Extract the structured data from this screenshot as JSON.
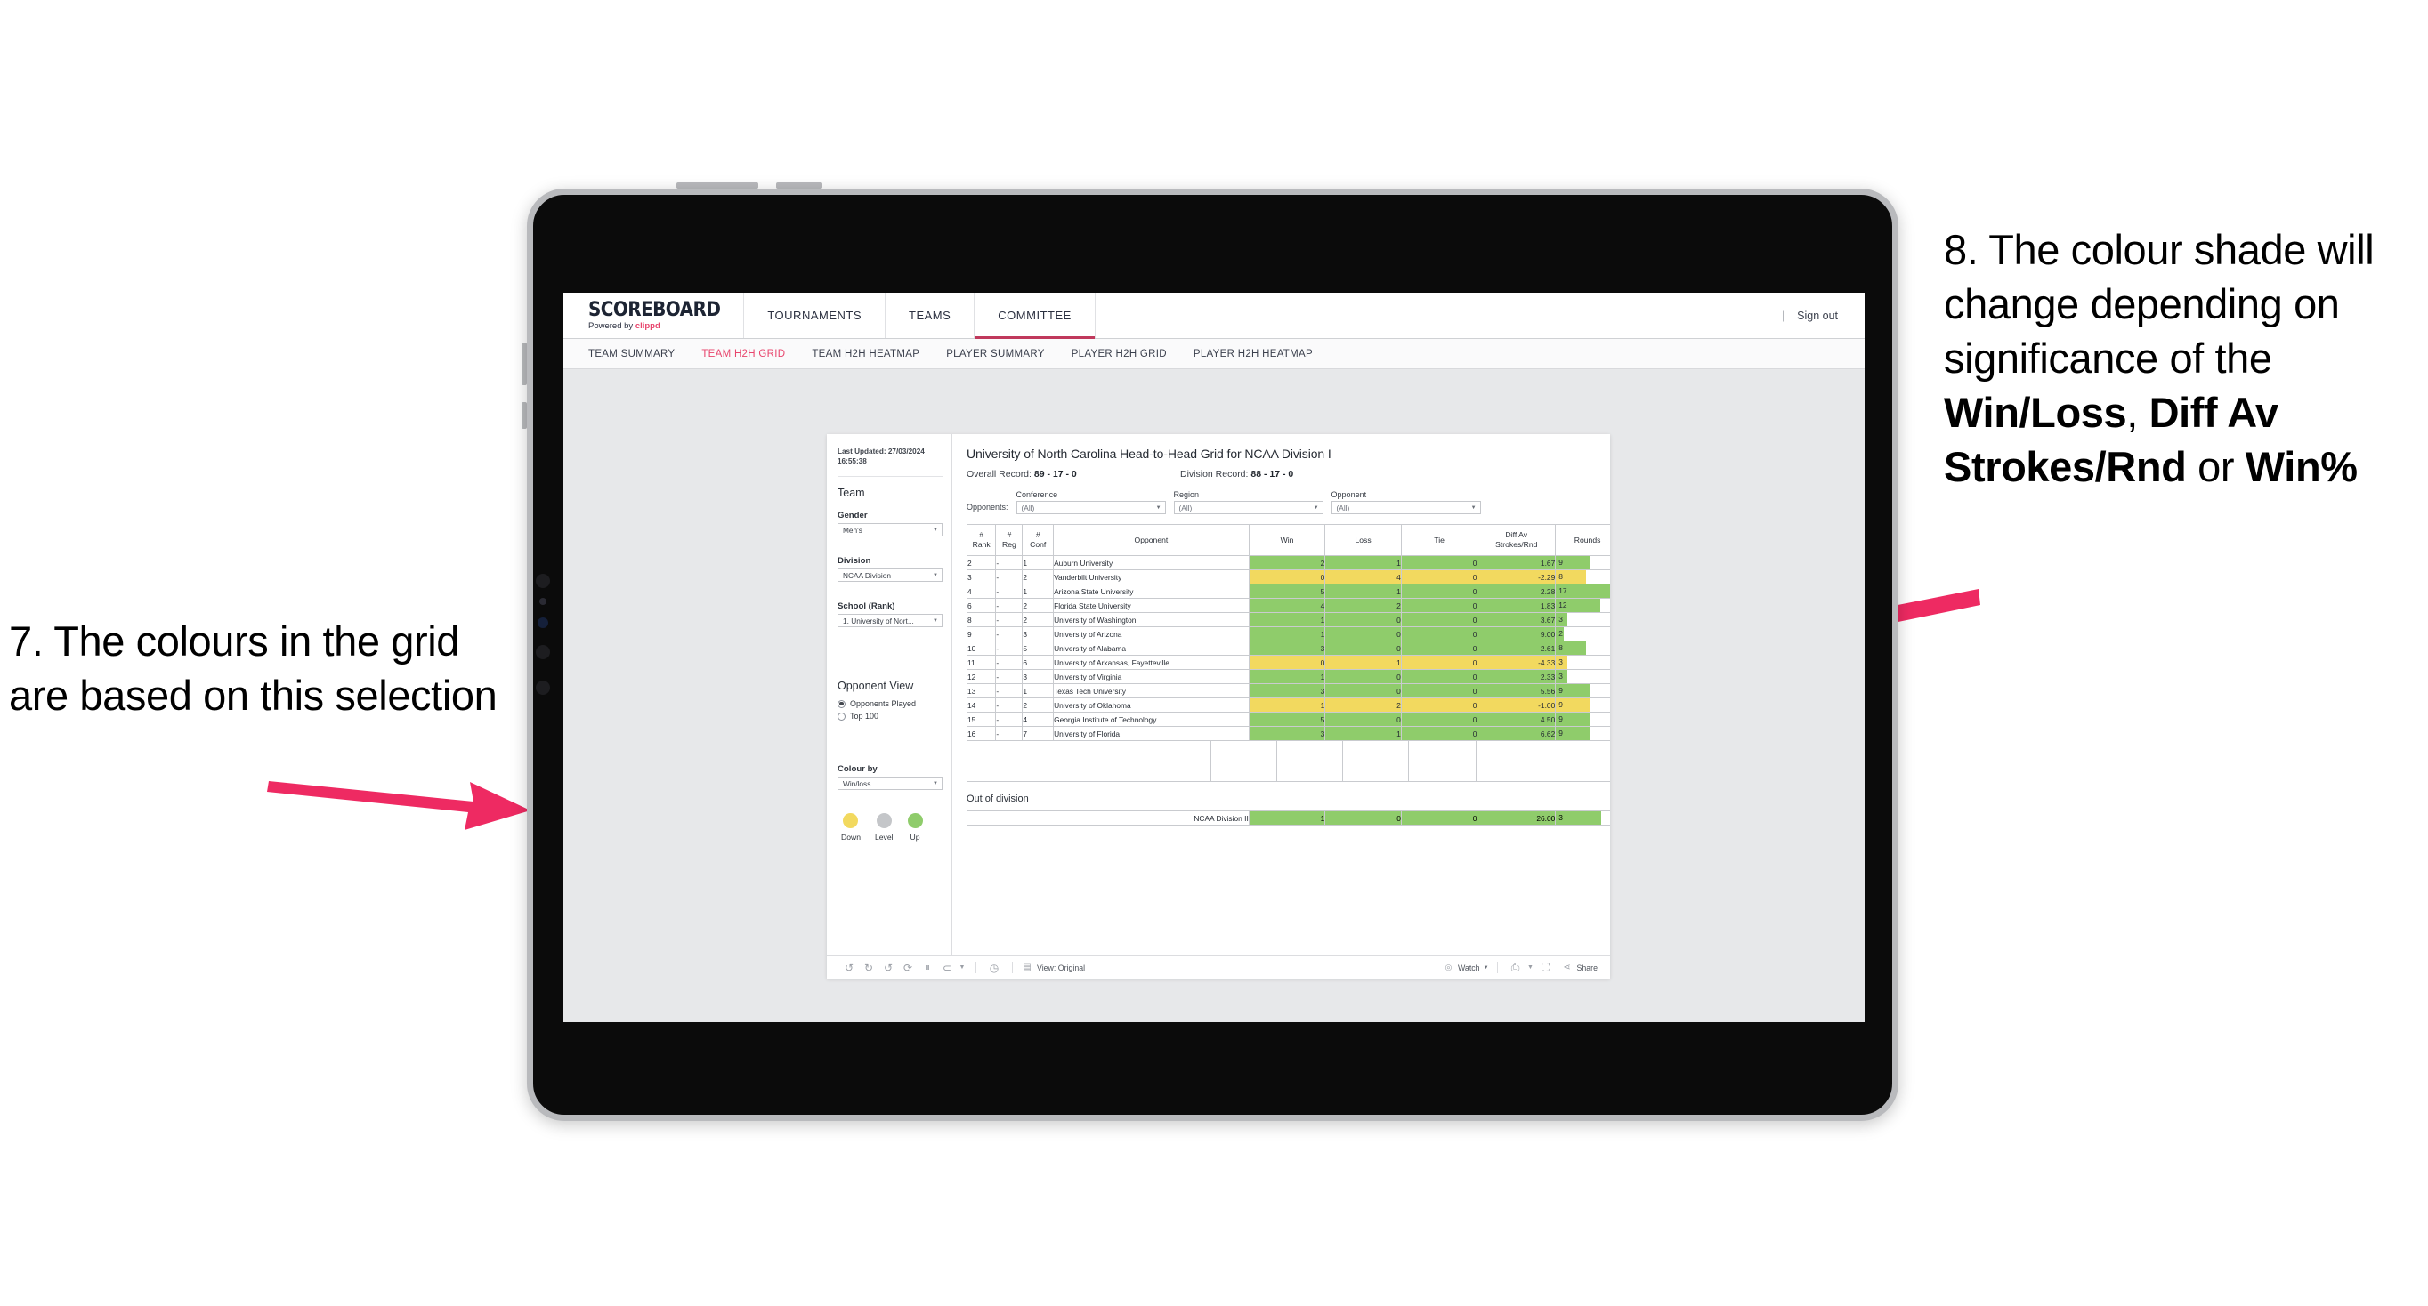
{
  "annotations": {
    "left": "7. The colours in the grid are based on this selection",
    "right_pre": "8. The colour shade will change depending on significance of the ",
    "right_b1": "Win/Loss",
    "right_mid1": ", ",
    "right_b2": "Diff Av Strokes/Rnd",
    "right_mid2": " or ",
    "right_b3": "Win%",
    "arrow_color": "#EE2A62"
  },
  "topnav": {
    "brand": "SCOREBOARD",
    "brand_sub_prefix": "Powered by ",
    "brand_sub_name": "clippd",
    "items": [
      {
        "label": "TOURNAMENTS",
        "active": false
      },
      {
        "label": "TEAMS",
        "active": false
      },
      {
        "label": "COMMITTEE",
        "active": true
      }
    ],
    "divider": "|",
    "signout": "Sign out"
  },
  "subnav": {
    "items": [
      {
        "label": "TEAM SUMMARY",
        "active": false
      },
      {
        "label": "TEAM H2H GRID",
        "active": true
      },
      {
        "label": "TEAM H2H HEATMAP",
        "active": false
      },
      {
        "label": "PLAYER SUMMARY",
        "active": false
      },
      {
        "label": "PLAYER H2H GRID",
        "active": false
      },
      {
        "label": "PLAYER H2H HEATMAP",
        "active": false
      }
    ]
  },
  "filters": {
    "last_updated": "Last Updated: 27/03/2024 16:55:38",
    "team_heading": "Team",
    "gender_label": "Gender",
    "gender_value": "Men's",
    "division_label": "Division",
    "division_value": "NCAA Division I",
    "school_label": "School (Rank)",
    "school_value": "1. University of Nort...",
    "opponent_view_heading": "Opponent View",
    "opponent_view_options": [
      {
        "label": "Opponents Played",
        "selected": true
      },
      {
        "label": "Top 100",
        "selected": false
      }
    ],
    "colour_by_label": "Colour by",
    "colour_by_value": "Win/loss",
    "legend": [
      {
        "label": "Down",
        "color": "#f2d95f"
      },
      {
        "label": "Level",
        "color": "#c4c6c9"
      },
      {
        "label": "Up",
        "color": "#8fcc6b"
      }
    ]
  },
  "viz": {
    "title": "University of North Carolina Head-to-Head Grid for NCAA Division I",
    "overall_record_label": "Overall Record: ",
    "overall_record_value": "89 - 17 - 0",
    "division_record_label": "Division Record: ",
    "division_record_value": "88 - 17 - 0",
    "opponents_label": "Opponents:",
    "opponent_filters": [
      {
        "caption": "Conference",
        "value": "(All)"
      },
      {
        "caption": "Region",
        "value": "(All)"
      },
      {
        "caption": "Opponent",
        "value": "(All)"
      }
    ]
  },
  "chart_data": {
    "type": "table",
    "title": "University of North Carolina Head-to-Head Grid for NCAA Division I",
    "columns": [
      "# Rank",
      "# Reg",
      "# Conf",
      "Opponent",
      "Win",
      "Loss",
      "Tie",
      "Diff Av Strokes/Rnd",
      "Rounds"
    ],
    "rounds_max": 17,
    "rows": [
      {
        "rank": "2",
        "reg": "-",
        "conf": "1",
        "opponent": "Auburn University",
        "win": "2",
        "loss": "1",
        "tie": "0",
        "diff": "1.67",
        "rounds": "9",
        "color": "green"
      },
      {
        "rank": "3",
        "reg": "-",
        "conf": "2",
        "opponent": "Vanderbilt University",
        "win": "0",
        "loss": "4",
        "tie": "0",
        "diff": "-2.29",
        "rounds": "8",
        "color": "yellow"
      },
      {
        "rank": "4",
        "reg": "-",
        "conf": "1",
        "opponent": "Arizona State University",
        "win": "5",
        "loss": "1",
        "tie": "0",
        "diff": "2.28",
        "rounds": "17",
        "color": "green"
      },
      {
        "rank": "6",
        "reg": "-",
        "conf": "2",
        "opponent": "Florida State University",
        "win": "4",
        "loss": "2",
        "tie": "0",
        "diff": "1.83",
        "rounds": "12",
        "color": "green"
      },
      {
        "rank": "8",
        "reg": "-",
        "conf": "2",
        "opponent": "University of Washington",
        "win": "1",
        "loss": "0",
        "tie": "0",
        "diff": "3.67",
        "rounds": "3",
        "color": "green"
      },
      {
        "rank": "9",
        "reg": "-",
        "conf": "3",
        "opponent": "University of Arizona",
        "win": "1",
        "loss": "0",
        "tie": "0",
        "diff": "9.00",
        "rounds": "2",
        "color": "green"
      },
      {
        "rank": "10",
        "reg": "-",
        "conf": "5",
        "opponent": "University of Alabama",
        "win": "3",
        "loss": "0",
        "tie": "0",
        "diff": "2.61",
        "rounds": "8",
        "color": "green"
      },
      {
        "rank": "11",
        "reg": "-",
        "conf": "6",
        "opponent": "University of Arkansas, Fayetteville",
        "win": "0",
        "loss": "1",
        "tie": "0",
        "diff": "-4.33",
        "rounds": "3",
        "color": "yellow"
      },
      {
        "rank": "12",
        "reg": "-",
        "conf": "3",
        "opponent": "University of Virginia",
        "win": "1",
        "loss": "0",
        "tie": "0",
        "diff": "2.33",
        "rounds": "3",
        "color": "green"
      },
      {
        "rank": "13",
        "reg": "-",
        "conf": "1",
        "opponent": "Texas Tech University",
        "win": "3",
        "loss": "0",
        "tie": "0",
        "diff": "5.56",
        "rounds": "9",
        "color": "green"
      },
      {
        "rank": "14",
        "reg": "-",
        "conf": "2",
        "opponent": "University of Oklahoma",
        "win": "1",
        "loss": "2",
        "tie": "0",
        "diff": "-1.00",
        "rounds": "9",
        "color": "yellow"
      },
      {
        "rank": "15",
        "reg": "-",
        "conf": "4",
        "opponent": "Georgia Institute of Technology",
        "win": "5",
        "loss": "0",
        "tie": "0",
        "diff": "4.50",
        "rounds": "9",
        "color": "green"
      },
      {
        "rank": "16",
        "reg": "-",
        "conf": "7",
        "opponent": "University of Florida",
        "win": "3",
        "loss": "1",
        "tie": "0",
        "diff": "6.62",
        "rounds": "9",
        "color": "green"
      }
    ],
    "out_of_division_title": "Out of division",
    "out_of_division": [
      {
        "name": "NCAA Division II",
        "win": "1",
        "loss": "0",
        "tie": "0",
        "diff": "26.00",
        "rounds": "3",
        "color": "green"
      }
    ]
  },
  "toolbar": {
    "view_label": "View: Original",
    "watch_label": "Watch",
    "share_label": "Share"
  }
}
